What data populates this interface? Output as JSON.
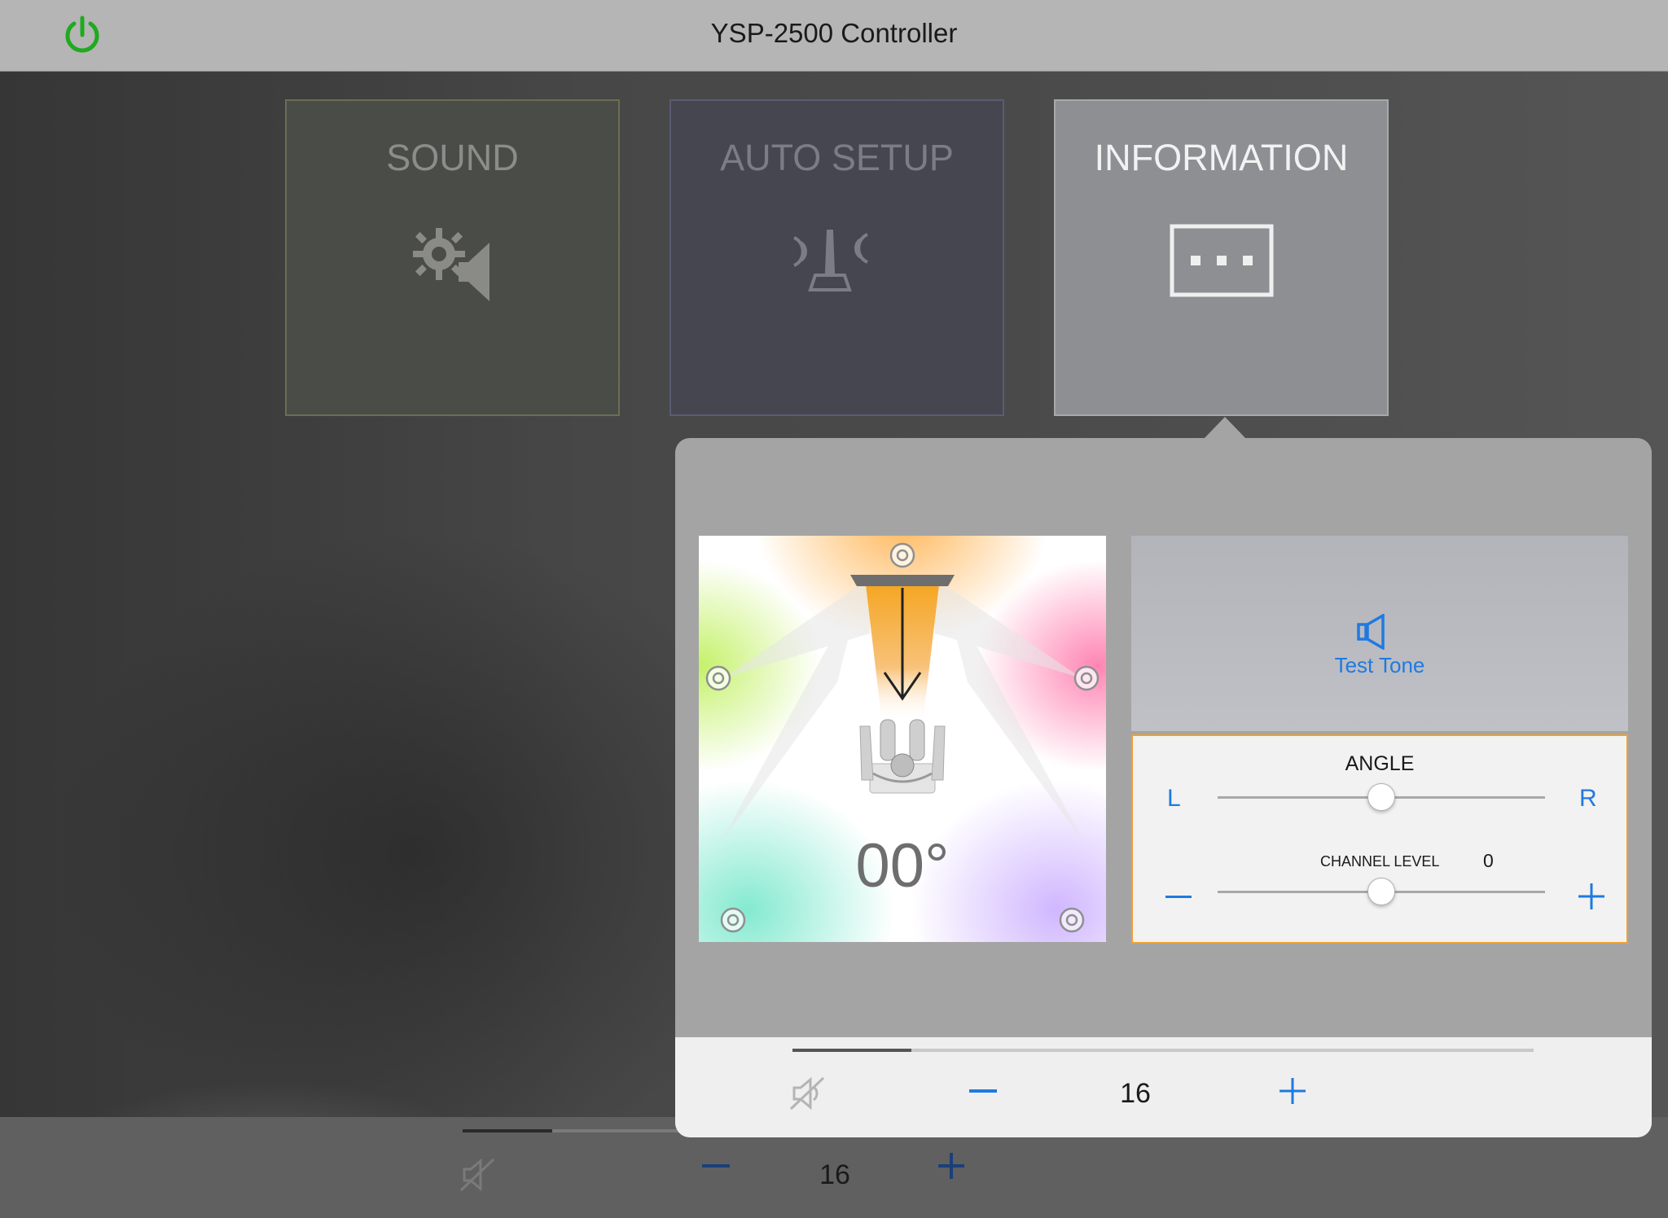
{
  "header": {
    "title": "YSP-2500 Controller",
    "power_color": "#1faa1f"
  },
  "tiles": [
    {
      "label": "SOUND",
      "icon": "gear-speaker-icon"
    },
    {
      "label": "AUTO SETUP",
      "icon": "microphone-icon"
    },
    {
      "label": "INFORMATION",
      "icon": "info-dots-icon",
      "selected": true
    }
  ],
  "popover": {
    "angle_readout": "00°",
    "test_tone": {
      "label": "Test Tone",
      "icon": "speaker-icon"
    },
    "angle": {
      "title": "ANGLE",
      "left_label": "L",
      "right_label": "R",
      "position": 0.5
    },
    "channel_level": {
      "title": "CHANNEL LEVEL",
      "value": "0",
      "position": 0.5
    },
    "volume": {
      "value": "16",
      "level": 0.16
    }
  },
  "bottom_bar": {
    "volume": "16",
    "level": 0.22
  },
  "colors": {
    "accent": "#1f7ae0",
    "highlight_border": "#f0a030"
  }
}
